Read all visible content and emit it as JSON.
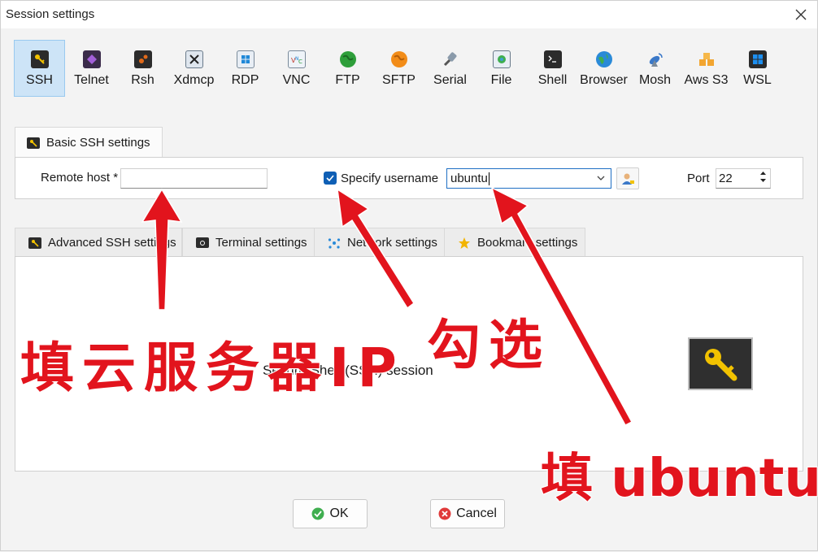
{
  "window": {
    "title": "Session settings"
  },
  "session_types": [
    {
      "label": "SSH",
      "icon": "ssh-key-icon",
      "color": "#2b2b2b",
      "selected": true
    },
    {
      "label": "Telnet",
      "icon": "telnet-icon",
      "color": "#7a3ea8"
    },
    {
      "label": "Rsh",
      "icon": "rsh-icon",
      "color": "#3a3a3a"
    },
    {
      "label": "Xdmcp",
      "icon": "xdmcp-icon",
      "color": "#5a6b7a"
    },
    {
      "label": "RDP",
      "icon": "rdp-icon",
      "color": "#1e88d8"
    },
    {
      "label": "VNC",
      "icon": "vnc-icon",
      "color": "#6aa0d0"
    },
    {
      "label": "FTP",
      "icon": "ftp-globe-icon",
      "color": "#2e9e3a"
    },
    {
      "label": "SFTP",
      "icon": "sftp-globe-icon",
      "color": "#f28c18"
    },
    {
      "label": "Serial",
      "icon": "serial-plug-icon",
      "color": "#7a8a9a"
    },
    {
      "label": "File",
      "icon": "file-monitor-icon",
      "color": "#3f9fd4"
    },
    {
      "label": "Shell",
      "icon": "shell-terminal-icon",
      "color": "#2b2b2b"
    },
    {
      "label": "Browser",
      "icon": "browser-globe-icon",
      "color": "#2a8ad8"
    },
    {
      "label": "Mosh",
      "icon": "mosh-satellite-icon",
      "color": "#3a78c8"
    },
    {
      "label": "Aws S3",
      "icon": "aws-s3-icon",
      "color": "#f2a530"
    },
    {
      "label": "WSL",
      "icon": "wsl-windows-icon",
      "color": "#1d6fd0"
    }
  ],
  "basic": {
    "tab_label": "Basic SSH settings",
    "remote_host_label": "Remote host *",
    "remote_host_value": "",
    "specify_username_label": "Specify username",
    "specify_username_checked": true,
    "username_value": "ubuntu",
    "port_label": "Port",
    "port_value": "22"
  },
  "lower_tabs": [
    {
      "label": "Advanced SSH settings",
      "icon": "key-icon"
    },
    {
      "label": "Terminal settings",
      "icon": "terminal-icon"
    },
    {
      "label": "Network settings",
      "icon": "network-icon"
    },
    {
      "label": "Bookmark settings",
      "icon": "star-icon"
    }
  ],
  "description": "Secure Shell (SSH) session",
  "buttons": {
    "ok": "OK",
    "cancel": "Cancel"
  },
  "annotations": {
    "host": "填云服务器IP",
    "checkbox": "勾选",
    "username": "填 ubuntu"
  },
  "colors": {
    "accent": "#0f5fb5",
    "annotation": "#e2141d",
    "selected_bg": "#cde4f7"
  }
}
